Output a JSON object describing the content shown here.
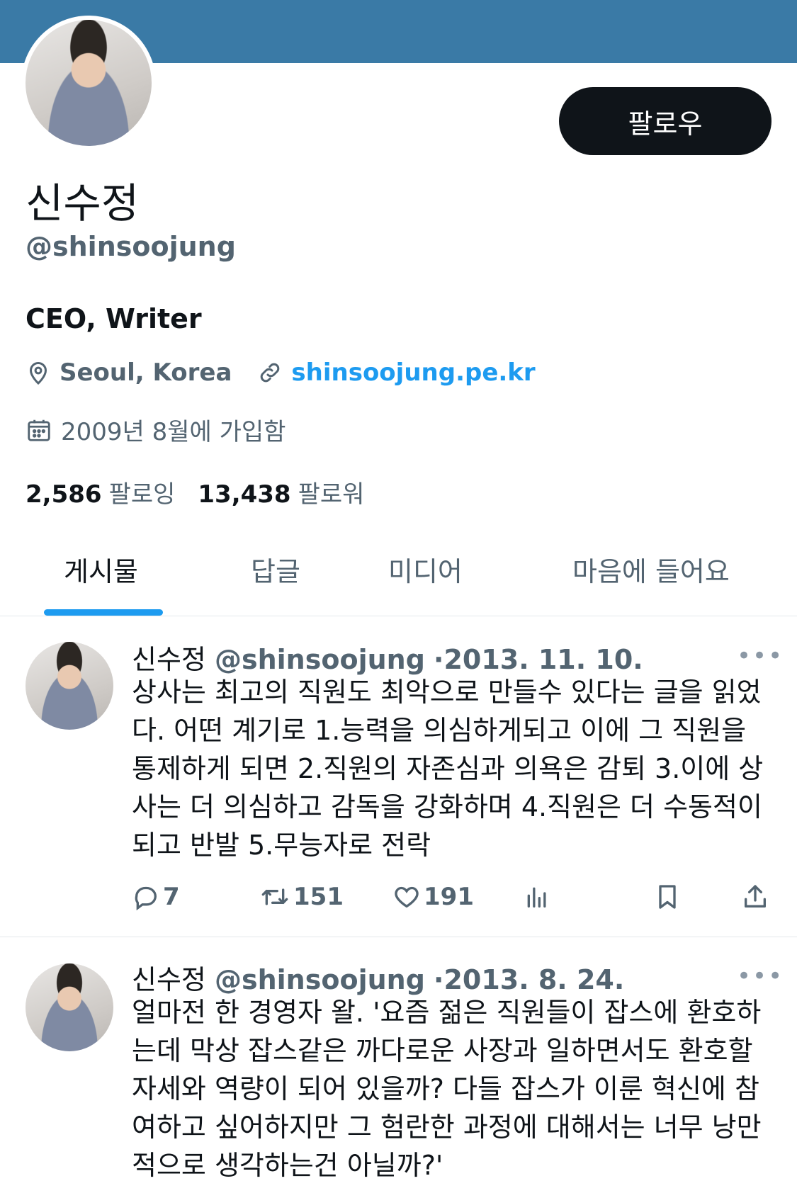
{
  "profile": {
    "follow_label": "팔로우",
    "name": "신수정",
    "handle": "@shinsoojung",
    "bio": "CEO, Writer",
    "location": "Seoul, Korea",
    "website": "shinsoojung.pe.kr",
    "joined": "2009년 8월에 가입함",
    "following_count": "2,586",
    "following_label": "팔로잉",
    "followers_count": "13,438",
    "followers_label": "팔로워"
  },
  "tabs": [
    {
      "label": "게시물",
      "active": true
    },
    {
      "label": "답글"
    },
    {
      "label": "미디어"
    },
    {
      "label": "마음에 들어요"
    }
  ],
  "tweets": [
    {
      "name": "신수정",
      "handle": "@shinsoojung",
      "separator": "·",
      "date": "2013. 11. 10.",
      "more": "•••",
      "text": "상사는 최고의 직원도 최악으로 만들수 있다는 글을 읽었다. 어떤 계기로 1.능력을 의심하게되고 이에 그 직원을 통제하게 되면 2.직원의 자존심과 의욕은 감퇴 3.이에 상사는 더 의심하고 감독을 강화하며 4.직원은 더 수동적이 되고 반발 5.무능자로 전락",
      "replies": "7",
      "retweets": "151",
      "likes": "191"
    },
    {
      "name": "신수정",
      "handle": "@shinsoojung",
      "separator": "·",
      "date": "2013. 8. 24.",
      "more": "•••",
      "text": "얼마전 한 경영자 왈. '요즘 젊은 직원들이 잡스에 환호하는데 막상 잡스같은 까다로운 사장과 일하면서도 환호할 자세와 역량이 되어 있을까? 다들 잡스가 이룬 혁신에 참여하고 싶어하지만 그 험란한 과정에 대해서는 너무 낭만적으로 생각하는건 아닐까?'"
    }
  ],
  "icons": {
    "location": "location-pin-icon",
    "link": "link-icon",
    "calendar": "calendar-icon",
    "reply": "reply-icon",
    "retweet": "retweet-icon",
    "like": "heart-icon",
    "views": "views-icon",
    "bookmark": "bookmark-icon",
    "share": "share-icon"
  },
  "colors": {
    "banner": "#3a7aa6",
    "accent": "#1d9bf0",
    "text": "#0f1419",
    "secondary": "#536471"
  }
}
